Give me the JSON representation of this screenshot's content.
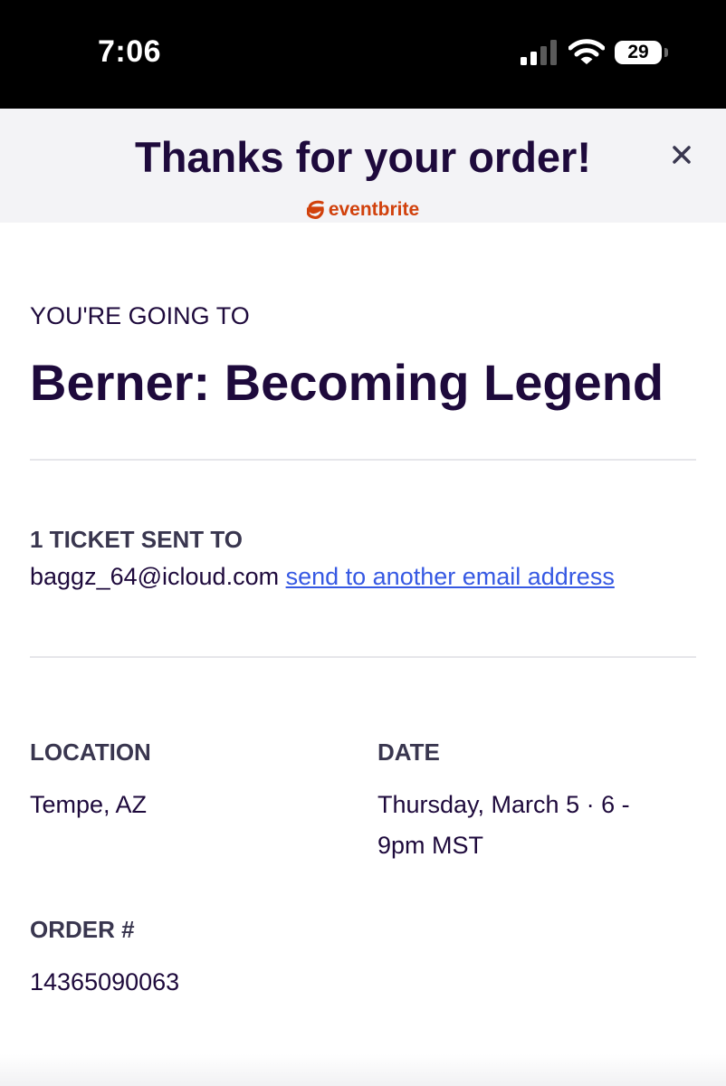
{
  "status_bar": {
    "time": "7:06",
    "battery_level": "29",
    "signal_icon": "cellular-signal-icon",
    "wifi_icon": "wifi-icon"
  },
  "header": {
    "title": "Thanks for your order!",
    "close_icon": "close-icon",
    "brand": "eventbrite",
    "brand_color": "#d1410c"
  },
  "event": {
    "label": "YOU'RE GOING TO",
    "title": "Berner: Becoming Legend"
  },
  "ticket": {
    "label": "1 TICKET SENT TO",
    "email": "baggz_64@icloud.com",
    "link_text": "send to another email address",
    "link_color": "#3659e3"
  },
  "details": {
    "location_label": "LOCATION",
    "location_value": "Tempe, AZ",
    "date_label": "DATE",
    "date_line1": "Thursday, March 5 · 6 -",
    "date_line2": "9pm MST",
    "order_label": "ORDER #",
    "order_value": "14365090063"
  }
}
